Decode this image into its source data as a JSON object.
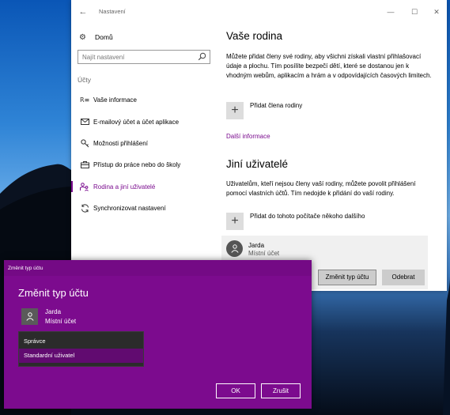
{
  "window": {
    "title": "Nastavení",
    "back_icon": "back-arrow-icon",
    "controls": {
      "minimize": "—",
      "maximize": "☐",
      "close": "✕"
    }
  },
  "nav": {
    "home_label": "Domů",
    "search_placeholder": "Najít nastavení",
    "section_label": "Účty",
    "items": [
      {
        "label": "Vaše informace",
        "icon": "person-card-icon",
        "active": false
      },
      {
        "label": "E-mailový účet a účet aplikace",
        "icon": "mail-icon",
        "active": false
      },
      {
        "label": "Možnosti přihlášení",
        "icon": "key-icon",
        "active": false
      },
      {
        "label": "Přístup do práce nebo do školy",
        "icon": "briefcase-icon",
        "active": false
      },
      {
        "label": "Rodina a jiní uživatelé",
        "icon": "family-icon",
        "active": true
      },
      {
        "label": "Synchronizovat nastavení",
        "icon": "sync-icon",
        "active": false
      }
    ]
  },
  "family": {
    "heading": "Vaše rodina",
    "description": "Můžete přidat členy své rodiny, aby všichni získali vlastní přihlašovací údaje a plochu. Tím posílíte bezpečí dětí, které se dostanou jen k vhodným webům, aplikacím a hrám a v odpovídajících časových limitech.",
    "add_label": "Přidat člena rodiny",
    "more_info_link": "Další informace"
  },
  "others": {
    "heading": "Jiní uživatelé",
    "description": "Uživatelům, kteří nejsou členy vaší rodiny, můžete povolit přihlášení pomocí vlastních účtů. Tím nedojde k přidání do vaší rodiny.",
    "add_label": "Přidat do tohoto počítače někoho dalšího",
    "user": {
      "name": "Jarda",
      "type": "Místní účet"
    },
    "change_type_button": "Změnit typ účtu",
    "remove_button": "Odebrat"
  },
  "dialog": {
    "title": "Změnit typ účtu",
    "heading": "Změnit typ účtu",
    "user": {
      "name": "Jarda",
      "type": "Místní účet"
    },
    "options": [
      "Správce",
      "Standardní uživatel"
    ],
    "highlighted_option": "Standardní uživatel",
    "ok_label": "OK",
    "cancel_label": "Zrušit"
  },
  "colors": {
    "accent": "#7c0b8e",
    "link": "#7a0b8e",
    "dropdown_bg": "#2b2b2b"
  }
}
